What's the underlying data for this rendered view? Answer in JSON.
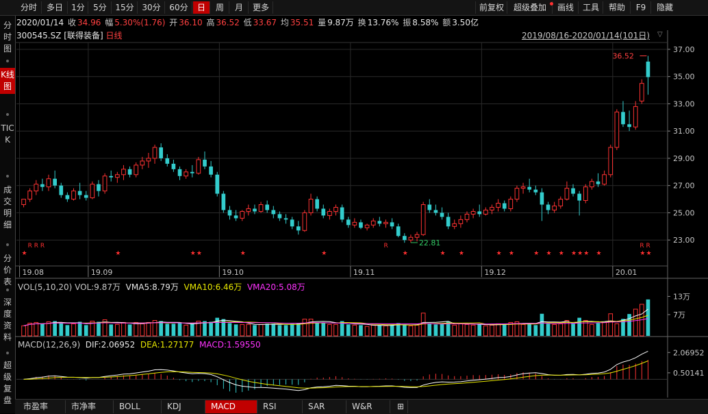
{
  "toolbar": {
    "periods": [
      "分时",
      "多日",
      "1分",
      "5分",
      "15分",
      "30分",
      "60分",
      "日",
      "周",
      "月",
      "更多"
    ],
    "active_period": "日",
    "right": [
      "前复权",
      "超级叠加",
      "画线",
      "工具",
      "帮助",
      "F9",
      "隐藏"
    ]
  },
  "sidebar": {
    "items": [
      "分时图",
      "K线图",
      "TICK",
      "成交明细",
      "分价表",
      "深度资料",
      "超级复盘"
    ],
    "active": "K线图"
  },
  "info": {
    "date": "2020/01/14",
    "close_label": "收",
    "close": "34.96",
    "change_label": "幅",
    "change": "5.30%(1.76)",
    "open_label": "开",
    "open": "36.10",
    "high_label": "高",
    "high": "36.52",
    "low_label": "低",
    "low": "33.67",
    "avg_label": "均",
    "avg": "35.51",
    "vol_label": "量",
    "vol": "9.87万",
    "turnover_label": "换",
    "turnover": "13.76%",
    "amp_label": "振",
    "amp": "8.58%",
    "amount_label": "额",
    "amount": "3.50亿"
  },
  "stock": {
    "code": "300545.SZ",
    "name": "[联得装备]",
    "period": "日线"
  },
  "date_range": "2019/08/16-2020/01/14(101日)",
  "price_annotations": {
    "high": "36.52",
    "low": "22.81"
  },
  "volume_panel": {
    "title": "VOL(5,10,20)",
    "vol": "VOL:9.87万",
    "vma5": "VMA5:8.79万",
    "vma10": "VMA10:6.46万",
    "vma20": "VMA20:5.08万",
    "axis": [
      "13万",
      "7万"
    ]
  },
  "macd_panel": {
    "title": "MACD(12,26,9)",
    "dif": "DIF:2.06952",
    "dea": "DEA:1.27177",
    "macd": "MACD:1.59550",
    "axis": [
      "2.06952",
      "0.50141"
    ]
  },
  "bottom_tabs": [
    "市盈率",
    "市净率",
    "BOLL",
    "KDJ",
    "MACD",
    "RSI",
    "SAR",
    "W&R"
  ],
  "active_tab": "MACD",
  "colors": {
    "up": "#ff3333",
    "down": "#33cccc",
    "accent": "#c00000",
    "bg": "#000000",
    "vma5": "#ffffff",
    "vma10": "#e8e800",
    "vma20": "#ff33ff"
  },
  "chart_data": {
    "type": "candlestick",
    "price_axis": [
      "37.00",
      "35.00",
      "33.00",
      "31.00",
      "29.00",
      "27.00",
      "25.00",
      "23.00"
    ],
    "date_axis": [
      "19.08",
      "19.09",
      "19.10",
      "19.11",
      "19.12",
      "20.01"
    ],
    "ylim": [
      21.5,
      37.5
    ],
    "candles": [
      [
        25.6,
        26.0,
        25.4,
        26.0
      ],
      [
        26.0,
        26.8,
        25.8,
        26.6
      ],
      [
        26.6,
        27.4,
        26.3,
        27.1
      ],
      [
        27.1,
        27.5,
        26.6,
        26.9
      ],
      [
        26.9,
        27.8,
        26.6,
        27.5
      ],
      [
        27.5,
        28.1,
        26.8,
        27.0
      ],
      [
        27.0,
        27.2,
        26.1,
        26.3
      ],
      [
        26.3,
        26.5,
        25.8,
        26.0
      ],
      [
        26.0,
        26.8,
        25.9,
        26.6
      ],
      [
        26.6,
        27.2,
        26.0,
        26.3
      ],
      [
        26.3,
        26.6,
        25.9,
        26.1
      ],
      [
        26.1,
        27.3,
        26.0,
        27.1
      ],
      [
        27.1,
        27.4,
        26.2,
        26.6
      ],
      [
        26.6,
        27.9,
        26.4,
        27.7
      ],
      [
        27.7,
        28.1,
        27.3,
        27.6
      ],
      [
        27.6,
        28.0,
        27.2,
        27.8
      ],
      [
        27.8,
        28.5,
        27.4,
        28.2
      ],
      [
        28.2,
        28.4,
        27.6,
        27.8
      ],
      [
        27.8,
        28.7,
        27.6,
        28.5
      ],
      [
        28.5,
        29.1,
        28.2,
        28.8
      ],
      [
        28.8,
        29.4,
        28.3,
        29.0
      ],
      [
        29.0,
        30.0,
        28.6,
        29.8
      ],
      [
        29.8,
        30.1,
        28.8,
        29.0
      ],
      [
        29.0,
        29.3,
        28.4,
        28.6
      ],
      [
        28.6,
        28.9,
        28.0,
        28.2
      ],
      [
        28.2,
        28.4,
        27.4,
        27.7
      ],
      [
        27.7,
        28.2,
        27.5,
        28.0
      ],
      [
        28.0,
        28.5,
        27.6,
        27.9
      ],
      [
        27.9,
        29.1,
        27.8,
        28.9
      ],
      [
        28.9,
        29.5,
        28.2,
        28.4
      ],
      [
        28.4,
        28.8,
        27.6,
        27.8
      ],
      [
        27.8,
        28.0,
        26.2,
        26.4
      ],
      [
        26.4,
        26.6,
        25.0,
        25.2
      ],
      [
        25.2,
        25.5,
        24.5,
        24.8
      ],
      [
        24.8,
        25.2,
        24.4,
        24.6
      ],
      [
        24.6,
        25.2,
        24.4,
        25.1
      ],
      [
        25.1,
        25.6,
        24.8,
        25.3
      ],
      [
        25.3,
        25.6,
        24.9,
        25.1
      ],
      [
        25.1,
        25.8,
        25.0,
        25.6
      ],
      [
        25.6,
        25.9,
        25.0,
        25.2
      ],
      [
        25.2,
        25.5,
        24.6,
        24.9
      ],
      [
        24.9,
        25.1,
        24.4,
        24.6
      ],
      [
        24.6,
        24.9,
        24.2,
        24.5
      ],
      [
        24.5,
        24.7,
        23.8,
        24.0
      ],
      [
        24.0,
        24.4,
        23.4,
        23.7
      ],
      [
        23.7,
        25.2,
        23.6,
        25.0
      ],
      [
        25.0,
        26.4,
        24.8,
        26.0
      ],
      [
        26.0,
        26.2,
        25.1,
        25.3
      ],
      [
        25.3,
        25.6,
        24.6,
        24.8
      ],
      [
        24.8,
        25.3,
        24.5,
        25.1
      ],
      [
        25.1,
        25.6,
        24.8,
        25.4
      ],
      [
        25.4,
        25.6,
        24.3,
        24.5
      ],
      [
        24.5,
        24.7,
        23.9,
        24.1
      ],
      [
        24.1,
        24.6,
        23.9,
        24.3
      ],
      [
        24.3,
        24.5,
        23.8,
        23.9
      ],
      [
        23.9,
        24.2,
        23.7,
        24.1
      ],
      [
        24.1,
        24.6,
        23.9,
        24.4
      ],
      [
        24.4,
        24.7,
        24.0,
        24.2
      ],
      [
        24.2,
        24.5,
        23.9,
        24.3
      ],
      [
        24.3,
        24.6,
        23.8,
        24.0
      ],
      [
        24.0,
        24.2,
        23.2,
        23.3
      ],
      [
        23.3,
        23.5,
        22.8,
        23.0
      ],
      [
        23.0,
        23.4,
        22.81,
        23.2
      ],
      [
        23.2,
        23.6,
        22.9,
        23.4
      ],
      [
        23.4,
        25.8,
        23.3,
        25.6
      ],
      [
        25.6,
        26.0,
        25.0,
        25.2
      ],
      [
        25.2,
        25.6,
        24.8,
        25.0
      ],
      [
        25.0,
        25.4,
        24.5,
        24.7
      ],
      [
        24.7,
        25.0,
        23.8,
        24.0
      ],
      [
        24.0,
        24.5,
        23.8,
        24.2
      ],
      [
        24.2,
        24.8,
        23.9,
        24.5
      ],
      [
        24.5,
        25.1,
        24.3,
        24.9
      ],
      [
        24.9,
        25.3,
        24.6,
        25.1
      ],
      [
        25.1,
        25.6,
        24.7,
        24.9
      ],
      [
        24.9,
        25.4,
        24.8,
        25.2
      ],
      [
        25.2,
        25.6,
        24.9,
        25.4
      ],
      [
        25.4,
        26.0,
        25.1,
        25.7
      ],
      [
        25.7,
        25.9,
        25.1,
        25.3
      ],
      [
        25.3,
        26.2,
        25.1,
        26.0
      ],
      [
        26.0,
        27.0,
        25.8,
        26.8
      ],
      [
        26.8,
        27.2,
        26.4,
        26.9
      ],
      [
        26.9,
        27.5,
        26.5,
        26.7
      ],
      [
        26.7,
        27.0,
        26.3,
        26.5
      ],
      [
        26.5,
        26.8,
        24.4,
        25.6
      ],
      [
        25.6,
        25.8,
        24.9,
        25.2
      ],
      [
        25.2,
        25.8,
        25.0,
        25.5
      ],
      [
        25.5,
        26.2,
        25.3,
        26.0
      ],
      [
        26.0,
        27.3,
        25.9,
        26.8
      ],
      [
        26.8,
        27.1,
        26.2,
        26.4
      ],
      [
        26.4,
        26.6,
        24.8,
        25.9
      ],
      [
        25.9,
        27.1,
        25.7,
        26.9
      ],
      [
        26.9,
        27.5,
        26.7,
        27.3
      ],
      [
        27.3,
        27.9,
        26.9,
        27.1
      ],
      [
        27.1,
        28.1,
        27.0,
        27.8
      ],
      [
        27.8,
        30.0,
        27.6,
        29.8
      ],
      [
        29.8,
        32.6,
        29.6,
        32.4
      ],
      [
        32.4,
        33.2,
        31.3,
        31.5
      ],
      [
        31.5,
        32.5,
        31.0,
        31.3
      ],
      [
        31.3,
        33.2,
        31.1,
        32.8
      ],
      [
        33.2,
        34.8,
        33.0,
        34.5
      ],
      [
        36.1,
        36.52,
        33.67,
        34.96
      ]
    ],
    "volume_ylim": [
      0,
      14
    ],
    "macd_ylim": [
      -1.3,
      2.4
    ]
  }
}
